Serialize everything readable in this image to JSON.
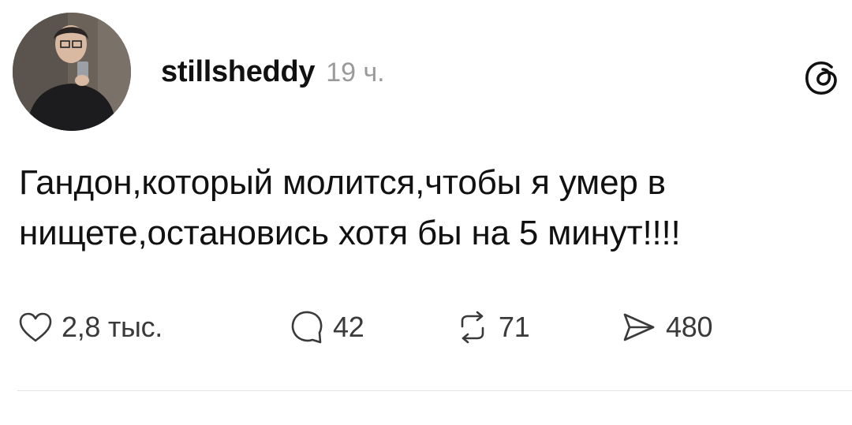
{
  "post": {
    "username": "stillsheddy",
    "timestamp": "19 ч.",
    "text_lines": [
      "Гандон,который молится,чтобы я умер в",
      "нищете,остановись хотя бы на 5 минут!!!!"
    ]
  },
  "actions": {
    "likes": {
      "icon": "heart-icon",
      "count": "2,8 тыс."
    },
    "replies": {
      "icon": "comment-icon",
      "count": "42"
    },
    "reposts": {
      "icon": "repost-icon",
      "count": "71"
    },
    "shares": {
      "icon": "share-icon",
      "count": "480"
    }
  },
  "colors": {
    "text": "#111111",
    "muted": "#9a9a9a",
    "icon": "#3a3a3a",
    "divider": "#e2e2e2"
  }
}
